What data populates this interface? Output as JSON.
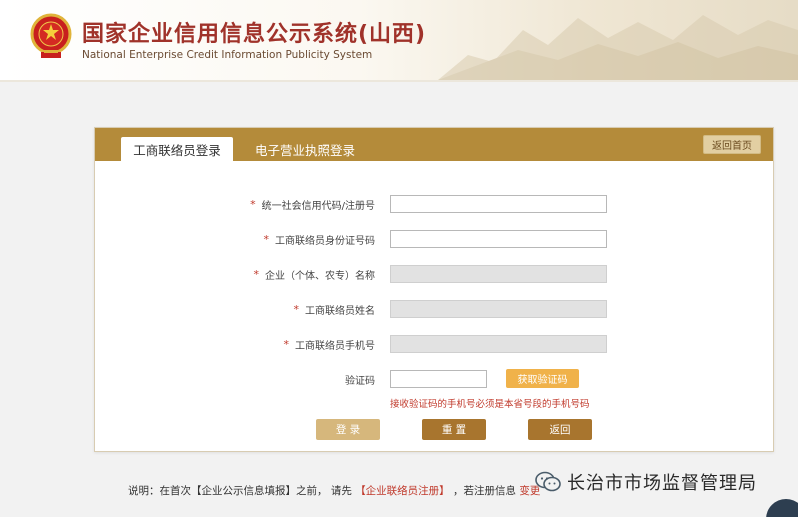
{
  "header": {
    "title_cn": "国家企业信用信息公示系统(山西)",
    "title_en": "National Enterprise Credit Information Publicity System"
  },
  "tabs": [
    {
      "label": "工商联络员登录",
      "active": true
    },
    {
      "label": "电子营业执照登录",
      "active": false
    }
  ],
  "back_home_label": "返回首页",
  "form": {
    "fields": [
      {
        "label": "统一社会信用代码/注册号",
        "required": true,
        "disabled": false
      },
      {
        "label": "工商联络员身份证号码",
        "required": true,
        "disabled": false
      },
      {
        "label": "企业（个体、农专）名称",
        "required": true,
        "disabled": true
      },
      {
        "label": "工商联络员姓名",
        "required": true,
        "disabled": true
      },
      {
        "label": "工商联络员手机号",
        "required": true,
        "disabled": true
      }
    ],
    "required_mark": "*",
    "code_label": "验证码",
    "get_code_label": "获取验证码",
    "hint": "接收验证码的手机号必须是本省号段的手机号码"
  },
  "buttons": {
    "login": "登 录",
    "reset": "重 置",
    "back": "返回"
  },
  "note": {
    "prefix": "说明：在首次【企业公示信息填报】之前， 请先",
    "link1": "【企业联络员注册】",
    "middle": "，若注册信息",
    "tail": "变更"
  },
  "watermark": "长治市市场监督管理局",
  "colors": {
    "accent": "#b48b3a",
    "title": "#a0322a",
    "required": "#c0392b"
  }
}
